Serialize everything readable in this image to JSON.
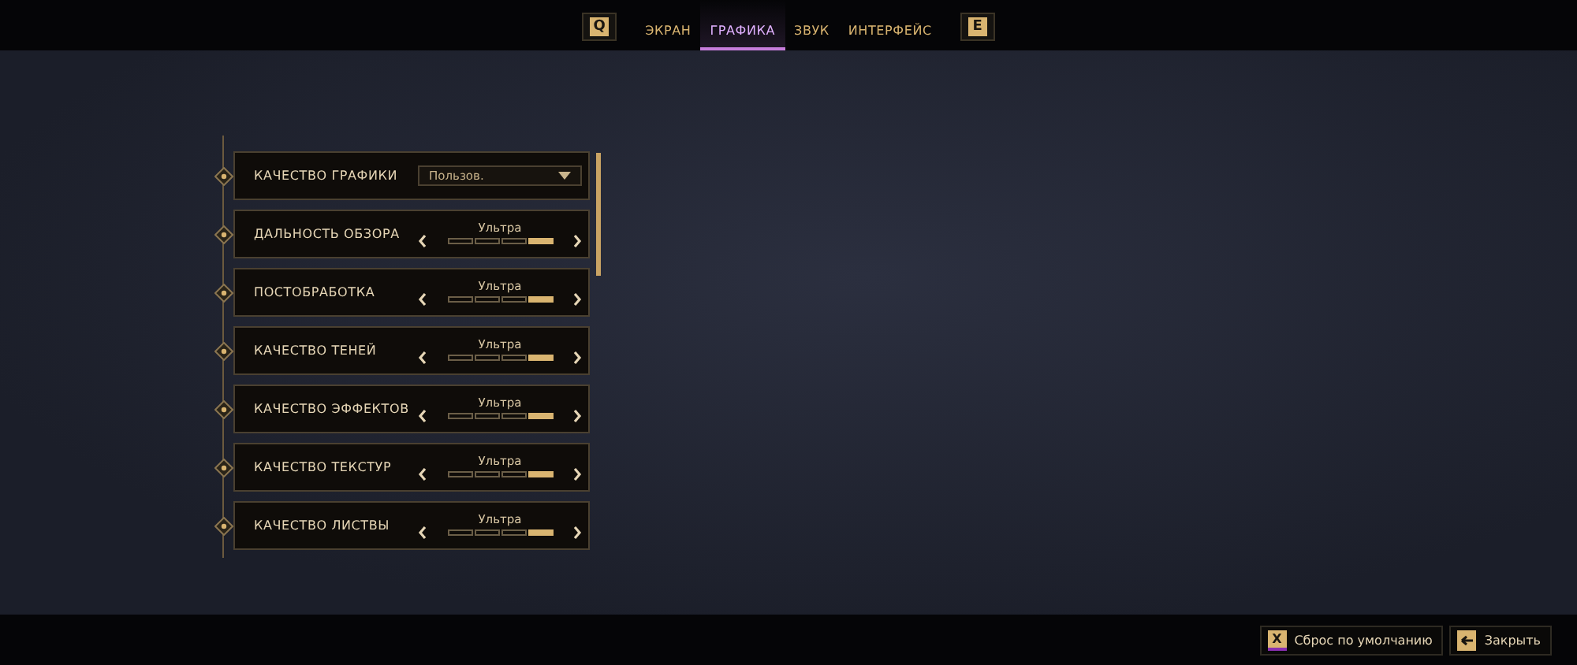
{
  "tabs_bar": {
    "prev_key": "Q",
    "next_key": "E",
    "tabs": [
      {
        "label": "ЭКРАН",
        "selected": false
      },
      {
        "label": "ГРАФИКА",
        "selected": true
      },
      {
        "label": "ЗВУК",
        "selected": false
      },
      {
        "label": "ИНТЕРФЕЙС",
        "selected": false
      }
    ]
  },
  "settings": [
    {
      "kind": "dropdown",
      "label": "КАЧЕСТВО ГРАФИКИ",
      "value": "Пользов."
    },
    {
      "kind": "selector",
      "label": "ДАЛЬНОСТЬ ОБЗОРА",
      "value": "Ультра",
      "segments": [
        {
          "selected": false
        },
        {
          "selected": false
        },
        {
          "selected": false
        },
        {
          "selected": true
        }
      ]
    },
    {
      "kind": "selector",
      "label": "ПОСТОБРАБОТКА",
      "value": "Ультра",
      "segments": [
        {
          "selected": false
        },
        {
          "selected": false
        },
        {
          "selected": false
        },
        {
          "selected": true
        }
      ]
    },
    {
      "kind": "selector",
      "label": "КАЧЕСТВО ТЕНЕЙ",
      "value": "Ультра",
      "segments": [
        {
          "selected": false
        },
        {
          "selected": false
        },
        {
          "selected": false
        },
        {
          "selected": true
        }
      ]
    },
    {
      "kind": "selector",
      "label": "КАЧЕСТВО ЭФФЕКТОВ",
      "value": "Ультра",
      "segments": [
        {
          "selected": false
        },
        {
          "selected": false
        },
        {
          "selected": false
        },
        {
          "selected": true
        }
      ]
    },
    {
      "kind": "selector",
      "label": "КАЧЕСТВО ТЕКСТУР",
      "value": "Ультра",
      "segments": [
        {
          "selected": false
        },
        {
          "selected": false
        },
        {
          "selected": false
        },
        {
          "selected": true
        }
      ]
    },
    {
      "kind": "selector",
      "label": "КАЧЕСТВО ЛИСТВЫ",
      "value": "Ультра",
      "segments": [
        {
          "selected": false
        },
        {
          "selected": false
        },
        {
          "selected": false
        },
        {
          "selected": true
        }
      ]
    }
  ],
  "footer": {
    "buttons": [
      {
        "kind": "key",
        "key": "X",
        "label": "Сброс по умолчанию"
      },
      {
        "kind": "back",
        "label": "Закрыть"
      }
    ]
  }
}
